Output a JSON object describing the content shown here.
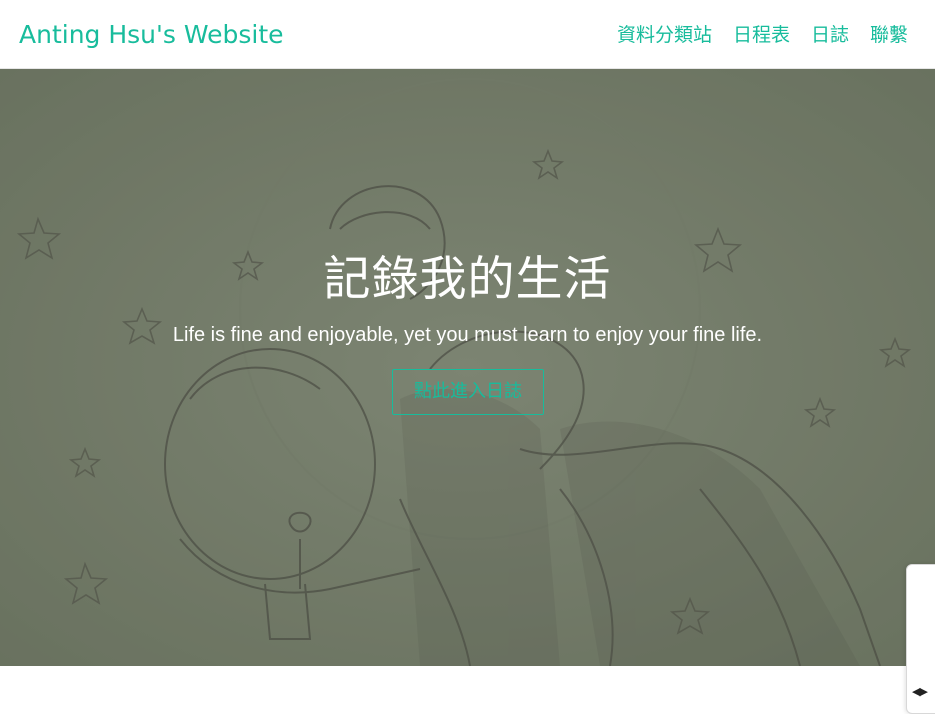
{
  "navbar": {
    "brand": "Anting Hsu's Website",
    "links": [
      {
        "label": "資料分類站"
      },
      {
        "label": "日程表"
      },
      {
        "label": "日誌"
      },
      {
        "label": "聯繫"
      }
    ]
  },
  "hero": {
    "title": "記錄我的生活",
    "subtitle": "Life is fine and enjoyable, yet you must learn to enjoy your fine life.",
    "button_label": "點此進入日誌",
    "background_description_icon": "sketch-hug-stars-image"
  },
  "widget": {
    "arrows": "◀▶"
  },
  "colors": {
    "accent": "#18bc9c",
    "hero_tint": "#8d947f",
    "text_on_hero": "#ffffff"
  }
}
